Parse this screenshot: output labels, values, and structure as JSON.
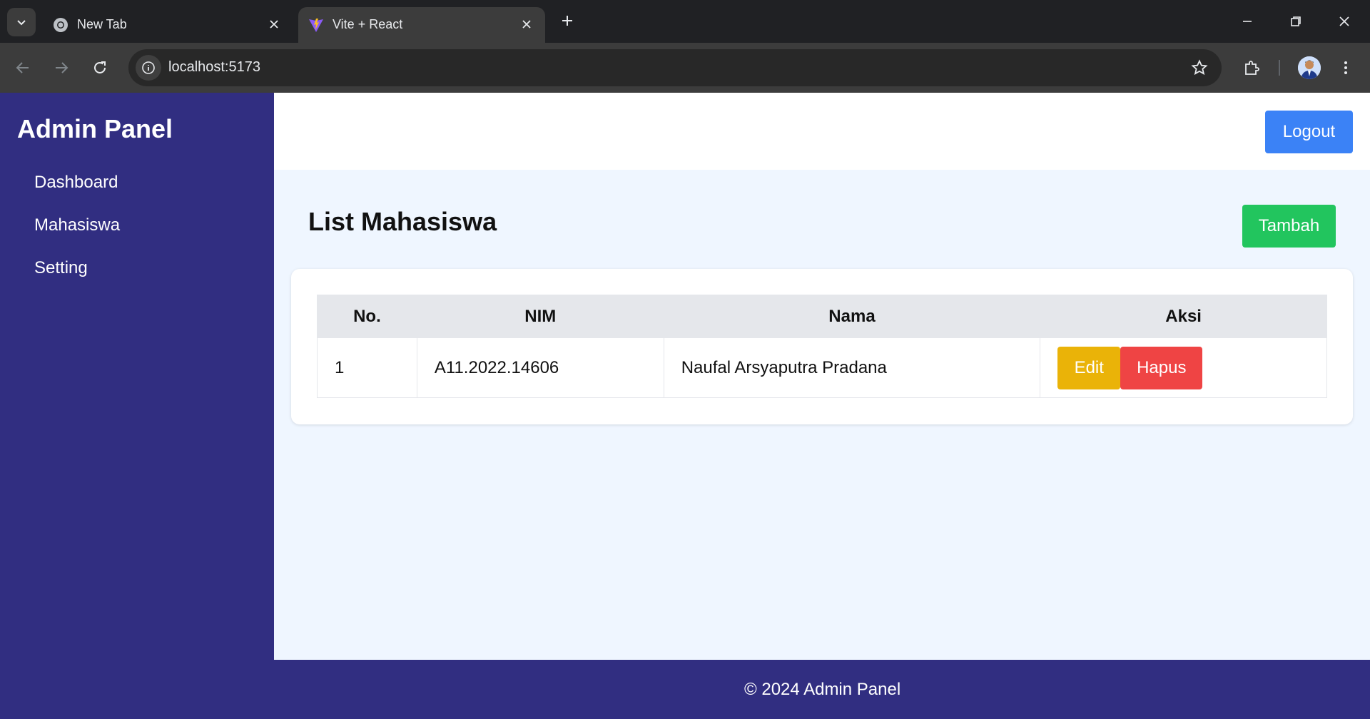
{
  "browser": {
    "tabs": [
      {
        "title": "New Tab",
        "favicon": "chrome-icon",
        "active": false
      },
      {
        "title": "Vite + React",
        "favicon": "vite-icon",
        "active": true
      }
    ],
    "url": "localhost:5173"
  },
  "sidebar": {
    "brand": "Admin Panel",
    "items": [
      {
        "label": "Dashboard"
      },
      {
        "label": "Mahasiswa"
      },
      {
        "label": "Setting"
      }
    ]
  },
  "header": {
    "logout_label": "Logout"
  },
  "main": {
    "title": "List Mahasiswa",
    "add_label": "Tambah",
    "table": {
      "columns": [
        "No.",
        "NIM",
        "Nama",
        "Aksi"
      ],
      "rows": [
        {
          "no": "1",
          "nim": "A11.2022.14606",
          "nama": "Naufal Arsyaputra Pradana",
          "edit_label": "Edit",
          "delete_label": "Hapus"
        }
      ]
    }
  },
  "footer": {
    "text": "© 2024 Admin Panel"
  },
  "colors": {
    "sidebar": "#312e81",
    "logout": "#3b82f6",
    "add": "#22c55e",
    "edit": "#eab308",
    "delete": "#ef4444",
    "content_bg": "#eff6ff"
  }
}
